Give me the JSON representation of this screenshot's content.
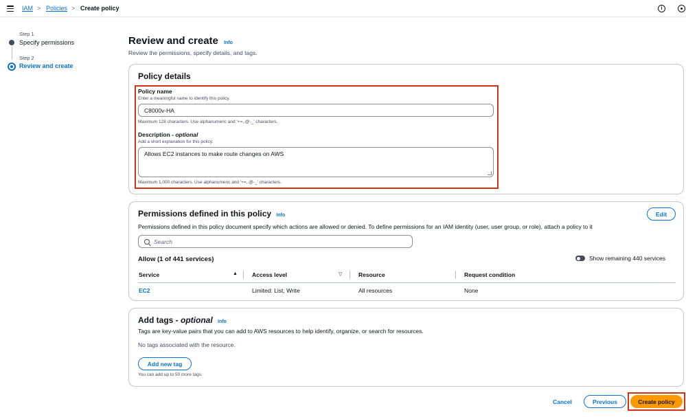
{
  "breadcrumb": {
    "items": [
      "IAM",
      "Policies",
      "Create policy"
    ],
    "separator": ">"
  },
  "header_icons": {
    "info": "i",
    "settings": "settings-icon"
  },
  "steps": [
    {
      "label": "Step 1",
      "title": "Specify permissions",
      "active": false
    },
    {
      "label": "Step 2",
      "title": "Review and create",
      "active": true
    }
  ],
  "page": {
    "title": "Review and create",
    "info": "Info",
    "description": "Review the permissions, specify details, and tags."
  },
  "policy_details": {
    "title": "Policy details",
    "name": {
      "label": "Policy name",
      "description": "Enter a meaningful name to identify this policy.",
      "value": "C8000v-HA",
      "constraint": "Maximum 128 characters. Use alphanumeric and '+=,.@-_' characters."
    },
    "description": {
      "label": "Description - ",
      "label_optional": "optional",
      "description": "Add a short explanation for this policy.",
      "value": "Allows EC2 instances to make route changes on AWS",
      "constraint": "Maximum 1,000 characters. Use alphanumeric and '+=,.@-_' characters."
    }
  },
  "permissions": {
    "title": "Permissions defined in this policy",
    "info": "Info",
    "edit_label": "Edit",
    "description": "Permissions defined in this policy document specify which actions are allowed or denied. To define permissions for an IAM identity (user, user group, or role), attach a policy to it",
    "search_placeholder": "Search",
    "allow_summary": "Allow (1 of 441 services)",
    "toggle_label": "Show remaining 440 services",
    "columns": [
      "Service",
      "Access level",
      "Resource",
      "Request condition"
    ],
    "rows": [
      {
        "service": "EC2",
        "access_level": "Limited: List, Write",
        "resource": "All resources",
        "condition": "None"
      }
    ]
  },
  "tags": {
    "title": "Add tags - ",
    "title_optional": "optional",
    "info": "Info",
    "description": "Tags are key-value pairs that you can add to AWS resources to help identify, organize, or search for resources.",
    "empty": "No tags associated with the resource.",
    "add_label": "Add new tag",
    "limit": "You can add up to 50 more tags."
  },
  "footer": {
    "cancel": "Cancel",
    "previous": "Previous",
    "create": "Create policy"
  },
  "colors": {
    "link": "#0972d3",
    "primary": "#ff9900",
    "highlight": "#d13212"
  }
}
